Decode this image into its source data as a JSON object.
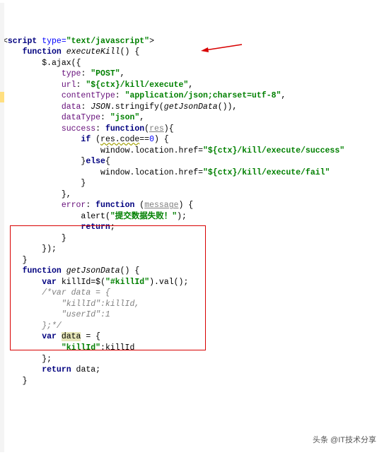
{
  "code": {
    "scriptOpen": "<script type=\"text/javascript\">",
    "fnExec": "executeKill",
    "ajax": "$.ajax({",
    "type": "type",
    "typeVal": "\"POST\"",
    "url": "url",
    "urlVal": "\"${ctx}/kill/execute\"",
    "contentType": "contentType",
    "contentTypeVal": "\"application/json;charset=utf-8\"",
    "data": "data",
    "dataVal": "JSON.stringify(getJsonData())",
    "dataType": "dataType",
    "dataTypeVal": "\"json\"",
    "success": "success",
    "resParam": "res",
    "ifCond": "res.code==0",
    "hrefSuccess": "\"${ctx}/kill/execute/success\"",
    "hrefFail": "\"${ctx}/kill/execute/fail\"",
    "error": "error",
    "msgParam": "message",
    "alertVal": "\"提交数据失败！\"",
    "fnGetJson": "getJsonData",
    "killIdVar": "killId",
    "killIdExpr": "$(\"#killId\").val();",
    "cmt1": "/*var data = {",
    "cmt2": "    \"killId\":killId,",
    "cmt3": "    \"userId\":1",
    "cmt4": "};*/",
    "dataVar": "data",
    "killIdKey": "\"killId\"",
    "returnData": "data",
    "window": "window",
    "location": "location",
    "href": "href",
    "alert": "alert",
    "jsonObj": "JSON",
    "stringify": "stringify",
    "function": "function",
    "var": "var",
    "return": "return",
    "if": "if",
    "else": "else"
  },
  "watermark": "头条 @IT技术分享"
}
